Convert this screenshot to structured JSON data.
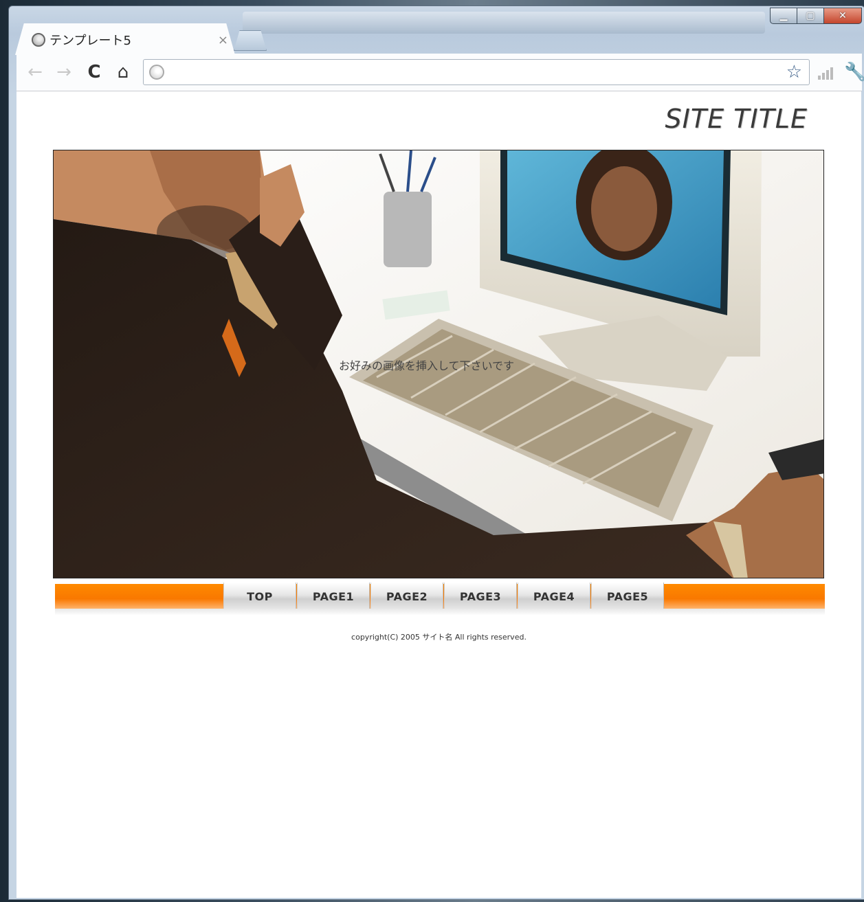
{
  "browser": {
    "tab_title": "テンプレート5",
    "tab_close": "×",
    "url": "",
    "icons": {
      "back": "left-arrow-icon",
      "forward": "right-arrow-icon",
      "reload": "reload-icon",
      "home": "home-icon",
      "bookmark": "star-icon",
      "signal": "signal-bars-icon",
      "menu": "wrench-icon"
    },
    "window_buttons": [
      "minimize",
      "maximize",
      "close"
    ]
  },
  "page": {
    "site_title": "SITE TITLE",
    "hero_caption": "お好みの画像を挿入して下さいです",
    "nav": [
      "TOP",
      "PAGE1",
      "PAGE2",
      "PAGE3",
      "PAGE4",
      "PAGE5"
    ],
    "footer": "copyright(C) 2005 サイト名 All rights reserved."
  },
  "colors": {
    "nav_accent": "#f97800",
    "title_text": "#3a3a3a"
  }
}
